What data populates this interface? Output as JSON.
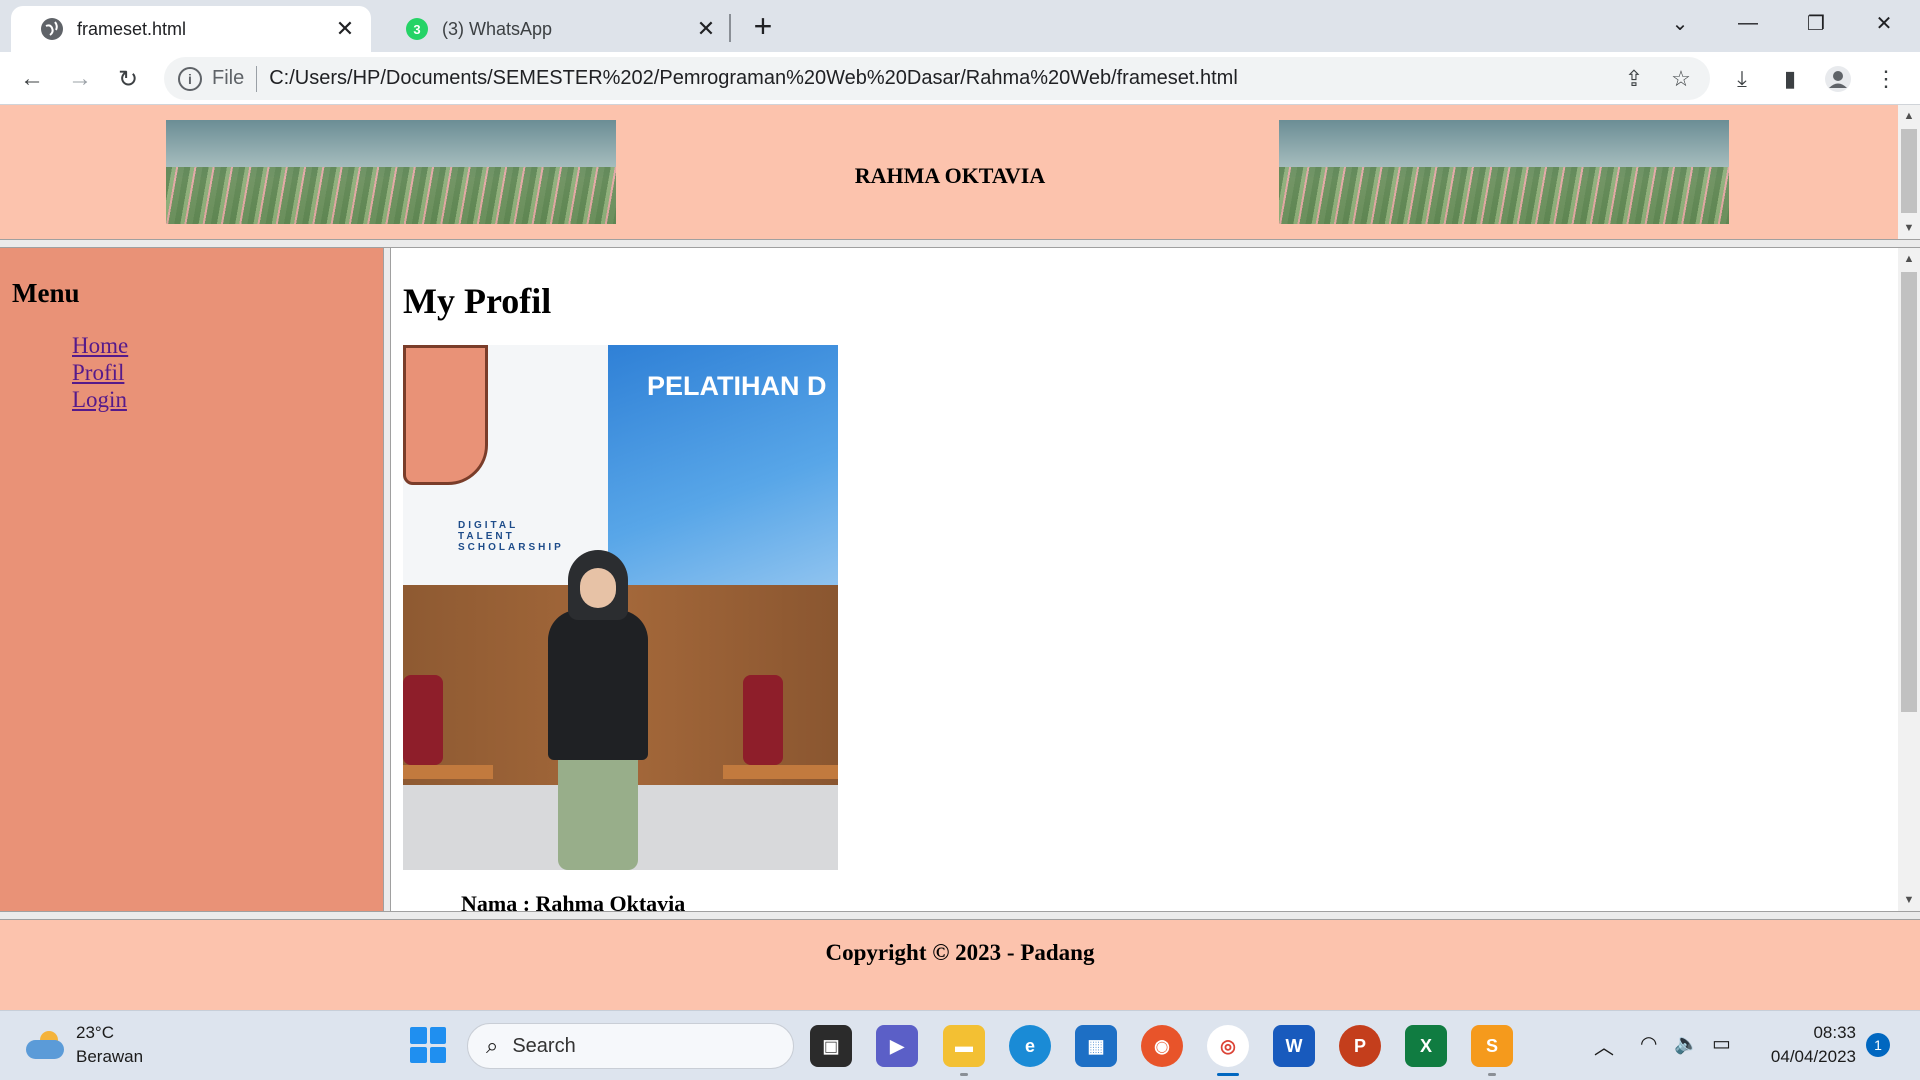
{
  "browser": {
    "tabs": [
      {
        "label": "frameset.html",
        "active": true
      },
      {
        "label": "(3) WhatsApp",
        "badge": "3",
        "active": false
      }
    ],
    "address": {
      "scheme": "File",
      "url": "C:/Users/HP/Documents/SEMESTER%202/Pemrograman%20Web%20Dasar/Rahma%20Web/frameset.html"
    }
  },
  "page": {
    "header": {
      "title": "RAHMA OKTAVIA"
    },
    "menu": {
      "title": "Menu",
      "items": [
        "Home",
        "Profil",
        "Login"
      ]
    },
    "main": {
      "heading": "My Profil",
      "photo_text": {
        "pelatihan": "PELATIHAN D",
        "dts": "DIGITAL TALENT SCHOLARSHIP"
      },
      "cut_text": "Nama : Rahma Oktavia"
    },
    "footer": {
      "copyright": "Copyright © 2023 - Padang"
    }
  },
  "taskbar": {
    "weather": {
      "temp": "23°C",
      "condition": "Berawan"
    },
    "search_placeholder": "Search",
    "clock": {
      "time": "08:33",
      "date": "04/04/2023"
    },
    "notification_count": "1"
  },
  "colors": {
    "header_bg": "#fcc3ad",
    "menu_bg": "#e99277",
    "link_visited": "#551a8b",
    "taskbar_accent": "#0067c0"
  }
}
